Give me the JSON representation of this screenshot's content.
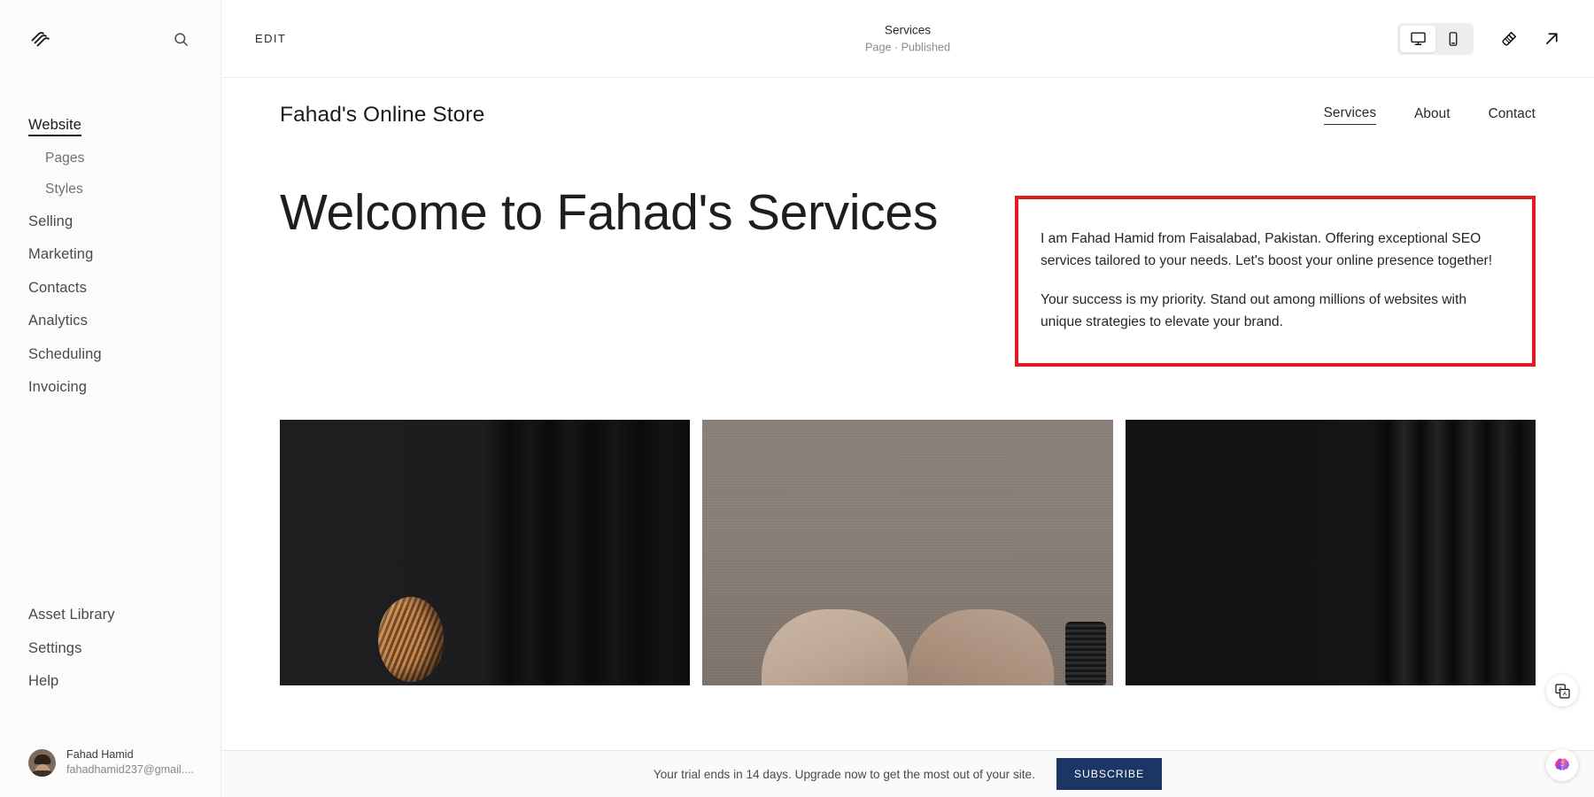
{
  "sidebar": {
    "logo_icon": "squarespace-logo",
    "search_icon": "search-icon",
    "primary_nav": [
      {
        "label": "Website",
        "active": true
      },
      {
        "label": "Pages",
        "sub": true
      },
      {
        "label": "Styles",
        "sub": true
      },
      {
        "label": "Selling"
      },
      {
        "label": "Marketing"
      },
      {
        "label": "Contacts"
      },
      {
        "label": "Analytics"
      },
      {
        "label": "Scheduling"
      },
      {
        "label": "Invoicing"
      }
    ],
    "secondary_nav": [
      {
        "label": "Asset Library"
      },
      {
        "label": "Settings"
      },
      {
        "label": "Help"
      }
    ],
    "user": {
      "name": "Fahad Hamid",
      "email": "fahadhamid237@gmail....",
      "avatar_icon": "user-avatar"
    }
  },
  "topbar": {
    "edit_label": "EDIT",
    "page_title": "Services",
    "page_status": "Page · Published",
    "devices": [
      {
        "icon": "desktop-icon",
        "selected": true
      },
      {
        "icon": "mobile-icon",
        "selected": false
      }
    ],
    "brush_icon": "paintbrush-icon",
    "open_icon": "external-link-icon"
  },
  "site": {
    "brand": "Fahad's Online Store",
    "nav": [
      {
        "label": "Services",
        "active": true
      },
      {
        "label": "About",
        "active": false
      },
      {
        "label": "Contact",
        "active": false
      }
    ],
    "hero_title": "Welcome to Fahad's Services",
    "callout": {
      "border_color": "#e01b24",
      "paragraphs": [
        "I am Fahad Hamid from Faisalabad, Pakistan. Offering exceptional SEO services tailored to your needs. Let's boost your online presence together!",
        "Your success is my priority. Stand out among millions of websites with unique strategies to elevate your brand."
      ]
    },
    "gallery": [
      {
        "name": "dark-room-with-copper-sphere"
      },
      {
        "name": "beige-wall-with-tan-armchair"
      },
      {
        "name": "dark-slatted-panel"
      }
    ]
  },
  "trial_banner": {
    "text": "Your trial ends in 14 days. Upgrade now to get the most out of your site.",
    "button_label": "SUBSCRIBE",
    "button_color": "#1b3665"
  },
  "floating": {
    "translate_icon": "translate-icon",
    "ai_icon": "ai-brain-icon"
  }
}
